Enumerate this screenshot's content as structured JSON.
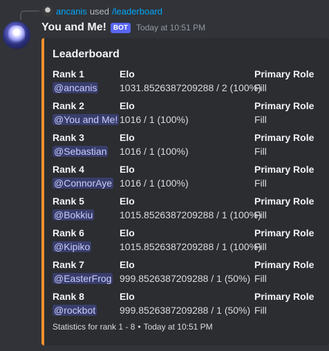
{
  "reply": {
    "user": "ancanis",
    "used": "used",
    "command": "/leaderboard"
  },
  "message": {
    "author": "You and Me!",
    "bot_tag": "BOT",
    "timestamp": "Today at 10:51 PM"
  },
  "embed": {
    "accent_color": "#f0902c",
    "title": "Leaderboard",
    "entries": [
      {
        "rank": "Rank 1",
        "elo_label": "Elo",
        "role_label": "Primary Role",
        "user": "@ancanis",
        "elo": "1031.8526387209288 / 2 (100%)",
        "role": "Fill"
      },
      {
        "rank": "Rank 2",
        "elo_label": "Elo",
        "role_label": "Primary Role",
        "user": "@You and Me!",
        "elo": "1016 / 1 (100%)",
        "role": "Fill"
      },
      {
        "rank": "Rank 3",
        "elo_label": "Elo",
        "role_label": "Primary Role",
        "user": "@Sebastian",
        "elo": "1016 / 1 (100%)",
        "role": "Fill"
      },
      {
        "rank": "Rank 4",
        "elo_label": "Elo",
        "role_label": "Primary Role",
        "user": "@ConnorAye",
        "elo": "1016 / 1 (100%)",
        "role": "Fill"
      },
      {
        "rank": "Rank 5",
        "elo_label": "Elo",
        "role_label": "Primary Role",
        "user": "@Bokkiu",
        "elo": "1015.8526387209288 / 1 (100%)",
        "role": "Fill"
      },
      {
        "rank": "Rank 6",
        "elo_label": "Elo",
        "role_label": "Primary Role",
        "user": "@Kipiko",
        "elo": "1015.8526387209288 / 1 (100%)",
        "role": "Fill"
      },
      {
        "rank": "Rank 7",
        "elo_label": "Elo",
        "role_label": "Primary Role",
        "user": "@EasterFrog",
        "elo": "999.8526387209288 / 1 (50%)",
        "role": "Fill"
      },
      {
        "rank": "Rank 8",
        "elo_label": "Elo",
        "role_label": "Primary Role",
        "user": "@rockbot",
        "elo": "999.8526387209288 / 1 (50%)",
        "role": "Fill"
      }
    ],
    "footer": {
      "text": "Statistics for rank 1 - 8",
      "separator": "•",
      "timestamp": "Today at 10:51 PM"
    }
  }
}
